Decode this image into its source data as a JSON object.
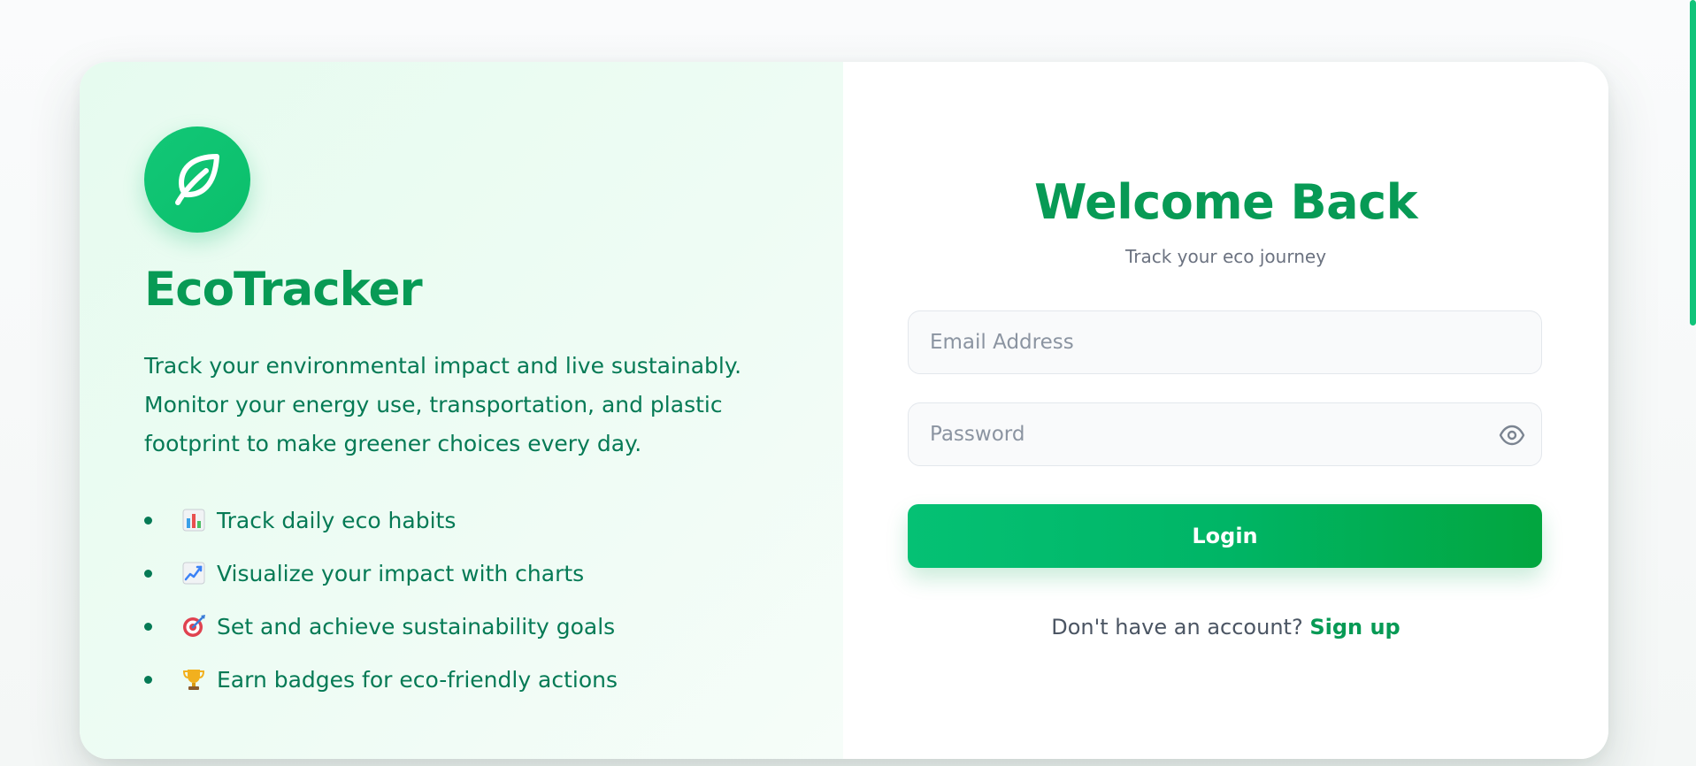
{
  "brand": {
    "name": "EcoTracker",
    "icon": "leaf-icon",
    "tagline": "Track your environmental impact and live sustainably. Monitor your energy use, transportation, and plastic footprint to make greener choices every day."
  },
  "features": [
    {
      "icon": "bar-chart-icon",
      "label": "Track daily eco habits"
    },
    {
      "icon": "trend-chart-icon",
      "label": "Visualize your impact with charts"
    },
    {
      "icon": "target-icon",
      "label": "Set and achieve sustainability goals"
    },
    {
      "icon": "trophy-icon",
      "label": "Earn badges for eco-friendly actions"
    }
  ],
  "login": {
    "title": "Welcome Back",
    "subtitle": "Track your eco journey",
    "email_placeholder": "Email Address",
    "password_placeholder": "Password",
    "password_toggle_icon": "eye-icon",
    "button_label": "Login",
    "signup_prompt": "Don't have an account?",
    "signup_link": "Sign up"
  },
  "colors": {
    "primary": "#079a55",
    "accent": "#00b566",
    "text_green": "#057a55",
    "muted": "#6b7280"
  }
}
